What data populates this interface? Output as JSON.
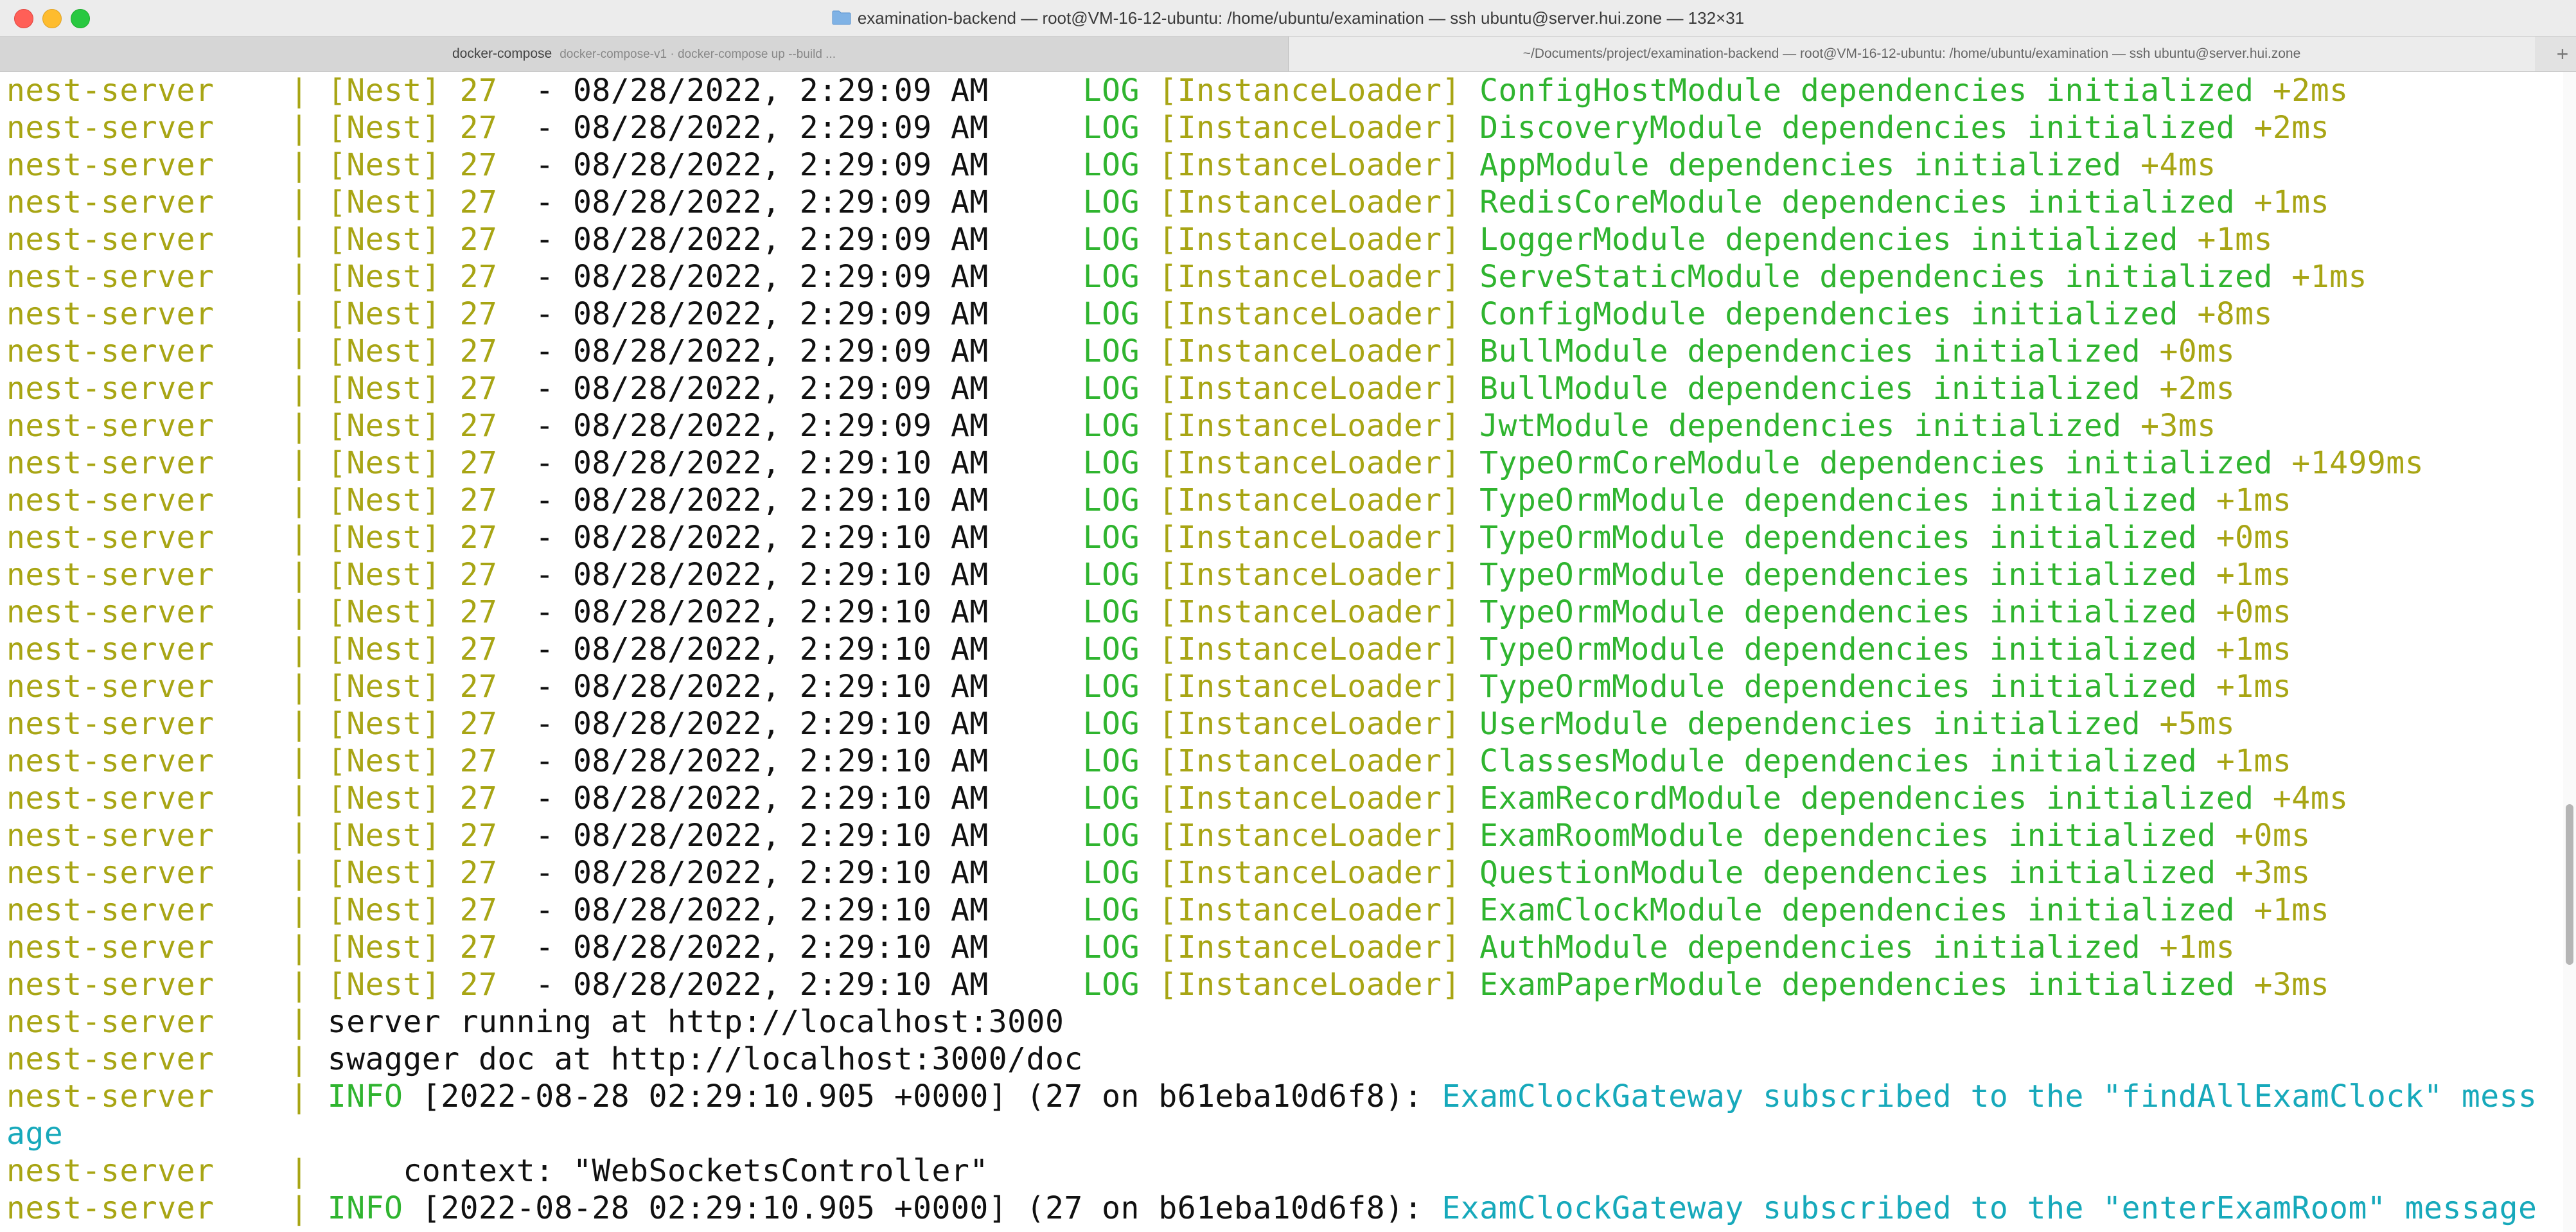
{
  "window": {
    "title": "examination-backend — root@VM-16-12-ubuntu: /home/ubuntu/examination — ssh ubuntu@server.hui.zone — 132×31"
  },
  "tabs": [
    {
      "name": "docker-compose",
      "subtitle": "docker-compose-v1 · docker-compose up --build ..."
    },
    {
      "name": "~/Documents/project/examination-backend — root@VM-16-12-ubuntu: /home/ubuntu/examination — ssh ubuntu@server.hui.zone",
      "subtitle": ""
    }
  ],
  "new_tab_label": "+",
  "log_common": {
    "container": "nest-server",
    "sep": "|",
    "app": "[Nest]",
    "pid": "27",
    "dash": "-",
    "level": "LOG",
    "context": "[InstanceLoader]"
  },
  "log_lines": [
    {
      "time": "08/28/2022, 2:29:09 AM",
      "msg": "ConfigHostModule dependencies initialized",
      "delta": "+2ms"
    },
    {
      "time": "08/28/2022, 2:29:09 AM",
      "msg": "DiscoveryModule dependencies initialized",
      "delta": "+2ms"
    },
    {
      "time": "08/28/2022, 2:29:09 AM",
      "msg": "AppModule dependencies initialized",
      "delta": "+4ms"
    },
    {
      "time": "08/28/2022, 2:29:09 AM",
      "msg": "RedisCoreModule dependencies initialized",
      "delta": "+1ms"
    },
    {
      "time": "08/28/2022, 2:29:09 AM",
      "msg": "LoggerModule dependencies initialized",
      "delta": "+1ms"
    },
    {
      "time": "08/28/2022, 2:29:09 AM",
      "msg": "ServeStaticModule dependencies initialized",
      "delta": "+1ms"
    },
    {
      "time": "08/28/2022, 2:29:09 AM",
      "msg": "ConfigModule dependencies initialized",
      "delta": "+8ms"
    },
    {
      "time": "08/28/2022, 2:29:09 AM",
      "msg": "BullModule dependencies initialized",
      "delta": "+0ms"
    },
    {
      "time": "08/28/2022, 2:29:09 AM",
      "msg": "BullModule dependencies initialized",
      "delta": "+2ms"
    },
    {
      "time": "08/28/2022, 2:29:09 AM",
      "msg": "JwtModule dependencies initialized",
      "delta": "+3ms"
    },
    {
      "time": "08/28/2022, 2:29:10 AM",
      "msg": "TypeOrmCoreModule dependencies initialized",
      "delta": "+1499ms"
    },
    {
      "time": "08/28/2022, 2:29:10 AM",
      "msg": "TypeOrmModule dependencies initialized",
      "delta": "+1ms"
    },
    {
      "time": "08/28/2022, 2:29:10 AM",
      "msg": "TypeOrmModule dependencies initialized",
      "delta": "+0ms"
    },
    {
      "time": "08/28/2022, 2:29:10 AM",
      "msg": "TypeOrmModule dependencies initialized",
      "delta": "+1ms"
    },
    {
      "time": "08/28/2022, 2:29:10 AM",
      "msg": "TypeOrmModule dependencies initialized",
      "delta": "+0ms"
    },
    {
      "time": "08/28/2022, 2:29:10 AM",
      "msg": "TypeOrmModule dependencies initialized",
      "delta": "+1ms"
    },
    {
      "time": "08/28/2022, 2:29:10 AM",
      "msg": "TypeOrmModule dependencies initialized",
      "delta": "+1ms"
    },
    {
      "time": "08/28/2022, 2:29:10 AM",
      "msg": "UserModule dependencies initialized",
      "delta": "+5ms"
    },
    {
      "time": "08/28/2022, 2:29:10 AM",
      "msg": "ClassesModule dependencies initialized",
      "delta": "+1ms"
    },
    {
      "time": "08/28/2022, 2:29:10 AM",
      "msg": "ExamRecordModule dependencies initialized",
      "delta": "+4ms"
    },
    {
      "time": "08/28/2022, 2:29:10 AM",
      "msg": "ExamRoomModule dependencies initialized",
      "delta": "+0ms"
    },
    {
      "time": "08/28/2022, 2:29:10 AM",
      "msg": "QuestionModule dependencies initialized",
      "delta": "+3ms"
    },
    {
      "time": "08/28/2022, 2:29:10 AM",
      "msg": "ExamClockModule dependencies initialized",
      "delta": "+1ms"
    },
    {
      "time": "08/28/2022, 2:29:10 AM",
      "msg": "AuthModule dependencies initialized",
      "delta": "+1ms"
    },
    {
      "time": "08/28/2022, 2:29:10 AM",
      "msg": "ExamPaperModule dependencies initialized",
      "delta": "+3ms"
    }
  ],
  "plain_lines": [
    "server running at http://localhost:3000",
    "swagger doc at http://localhost:3000/doc"
  ],
  "info1": {
    "level": "INFO",
    "meta": "[2022-08-28 02:29:10.905 +0000] (27 on b61eba10d6f8):",
    "msg": "ExamClockGateway subscribed to the \"findAllExamClock\" mess",
    "wrap": "age"
  },
  "context_line": "    context: \"WebSocketsController\"",
  "info2": {
    "level": "INFO",
    "meta": "[2022-08-28 02:29:10.905 +0000] (27 on b61eba10d6f8):",
    "msg": "ExamClockGateway subscribed to the \"enterExamRoom\" message"
  },
  "colors": {
    "prefix": "#a8a514",
    "message": "#2fb42f",
    "info_message": "#17a9bb",
    "plain": "#111111"
  }
}
